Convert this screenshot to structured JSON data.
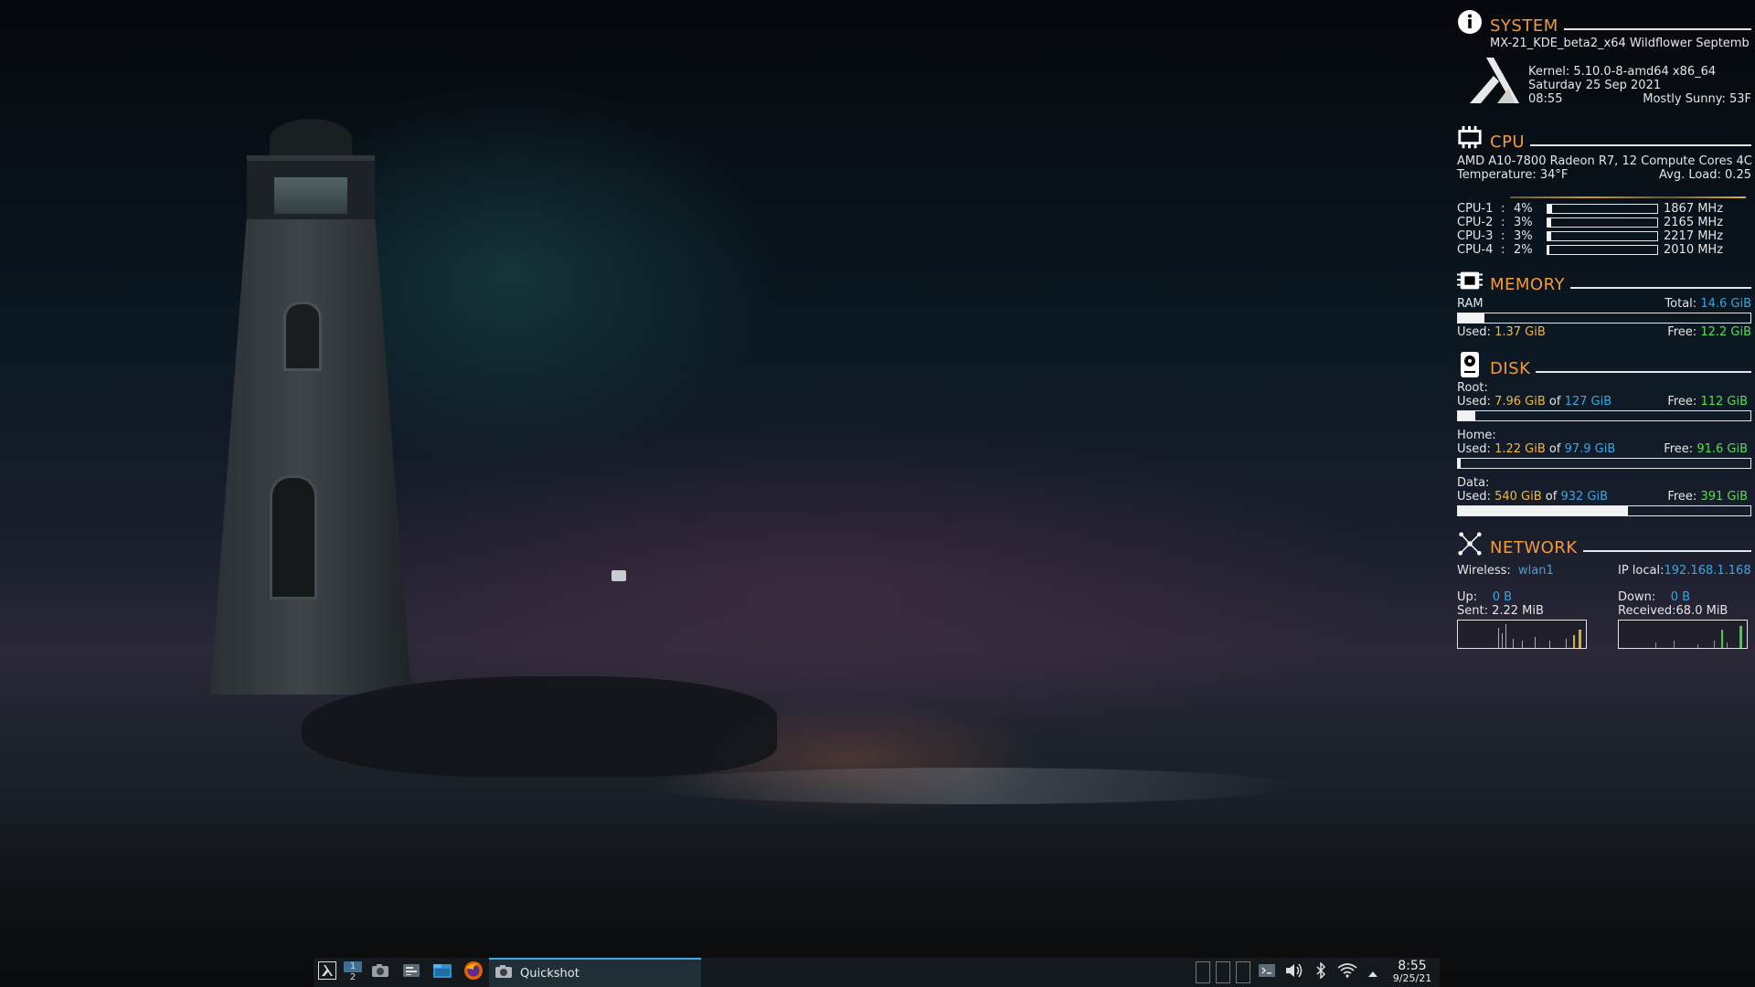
{
  "system": {
    "title": "SYSTEM",
    "distro": "MX-21_KDE_beta2_x64 Wildflower Septemb",
    "kernel": "Kernel: 5.10.0-8-amd64 x86_64",
    "date": "Saturday 25 Sep 2021",
    "time": "08:55",
    "weather": "Mostly Sunny: 53F"
  },
  "cpu": {
    "title": "CPU",
    "model": "AMD A10-7800 Radeon R7, 12 Compute Cores 4C",
    "temperature": "Temperature: 34°F",
    "avg_load": "Avg. Load: 0.25",
    "cores": [
      {
        "name": "CPU-1",
        "sep": ":",
        "pct": "4%",
        "mhz": "1867 MHz",
        "usage": 0.04
      },
      {
        "name": "CPU-2",
        "sep": ":",
        "pct": "3%",
        "mhz": "2165 MHz",
        "usage": 0.03
      },
      {
        "name": "CPU-3",
        "sep": ":",
        "pct": "3%",
        "mhz": "2217 MHz",
        "usage": 0.03
      },
      {
        "name": "CPU-4",
        "sep": ":",
        "pct": "2%",
        "mhz": "2010 MHz",
        "usage": 0.02
      }
    ]
  },
  "memory": {
    "title": "MEMORY",
    "ram_label": "RAM",
    "total_label": "Total:",
    "total": "14.6 GiB",
    "used_label": "Used:",
    "used": "1.37 GiB",
    "free_label": "Free:",
    "free": "12.2 GiB",
    "usage": 0.09
  },
  "disk": {
    "title": "DISK",
    "volumes": [
      {
        "label": "Root:",
        "used_label": "Used:",
        "used": "7.96 GiB",
        "of": "of",
        "size": "127 GiB",
        "free_label": "Free:",
        "free": "112 GiB",
        "usage": 0.06
      },
      {
        "label": "Home:",
        "used_label": "Used:",
        "used": "1.22 GiB",
        "of": "of",
        "size": "97.9 GiB",
        "free_label": "Free:",
        "free": "91.6 GiB",
        "usage": 0.01
      },
      {
        "label": "Data:",
        "used_label": "Used:",
        "used": "540 GiB",
        "of": "of",
        "size": "932 GiB",
        "free_label": "Free:",
        "free": "391 GiB",
        "usage": 0.58
      }
    ]
  },
  "network": {
    "title": "NETWORK",
    "wireless_label": "Wireless:",
    "interface": "wlan1",
    "ip_label": "IP local:",
    "ip": "192.168.1.168",
    "up_label": "Up:",
    "up": "0 B",
    "sent_label": "Sent:",
    "sent": "2.22 MiB",
    "down_label": "Down:",
    "down": "0 B",
    "received_label": "Received:",
    "received": "68.0 MiB"
  },
  "taskbar": {
    "pager_1": "1",
    "pager_2": "2",
    "task_label": "Quickshot",
    "clock_time": "8:55",
    "clock_date": "9/25/21"
  },
  "colors": {
    "section_title": "#f39a3c",
    "value_orange": "#f0b93a",
    "value_blue": "#3aa6e0",
    "value_green": "#52e04b",
    "taskbar_bg": "#161b20",
    "accent": "#3daee9"
  },
  "icons": [
    "info-icon",
    "mx-logo-icon",
    "cpu-icon",
    "memory-icon",
    "disk-icon",
    "network-icon",
    "application-menu-icon",
    "screenshot-icon",
    "settings-icon",
    "file-manager-icon",
    "firefox-icon",
    "terminal-icon",
    "volume-icon",
    "bluetooth-icon",
    "wifi-icon",
    "expand-tray-icon"
  ]
}
